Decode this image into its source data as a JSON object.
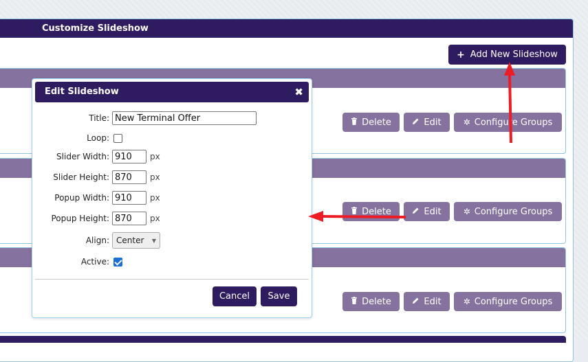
{
  "panel": {
    "title": "Customize Slideshow"
  },
  "toolbar": {
    "add_label": "Add New Slideshow"
  },
  "rows": [
    {
      "delete_label": "Delete",
      "edit_label": "Edit",
      "configure_label": "Configure Groups"
    },
    {
      "delete_label": "Delete",
      "edit_label": "Edit",
      "configure_label": "Configure Groups"
    },
    {
      "delete_label": "Delete",
      "edit_label": "Edit",
      "configure_label": "Configure Groups"
    }
  ],
  "modal": {
    "title": "Edit Slideshow",
    "close_symbol": "✖",
    "fields": {
      "title_label": "Title:",
      "title_value": "New Terminal Offer",
      "loop_label": "Loop:",
      "slider_width_label": "Slider Width:",
      "slider_width_value": "910",
      "slider_height_label": "Slider Height:",
      "slider_height_value": "870",
      "popup_width_label": "Popup Width:",
      "popup_width_value": "910",
      "popup_height_label": "Popup Height:",
      "popup_height_value": "870",
      "unit": "px",
      "align_label": "Align:",
      "align_value": "Center",
      "active_label": "Active:"
    },
    "cancel_label": "Cancel",
    "save_label": "Save"
  },
  "colors": {
    "brand_dark": "#2f1b5f",
    "brand_muted": "#85729f",
    "annotation_arrow": "#ee1c24"
  }
}
